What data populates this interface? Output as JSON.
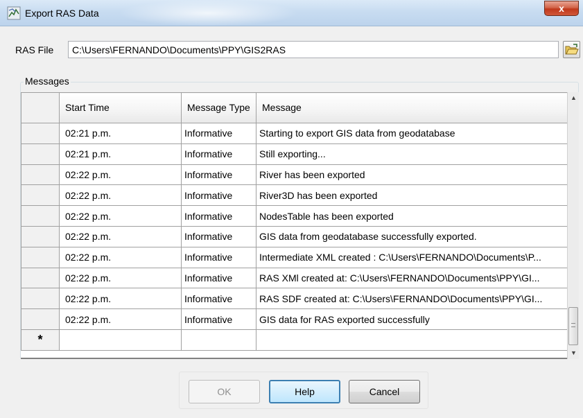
{
  "window": {
    "title": "Export RAS Data",
    "close_label": "x"
  },
  "ras_file": {
    "label": "RAS File",
    "value": "C:\\Users\\FERNANDO\\Documents\\PPY\\GIS2RAS"
  },
  "messages": {
    "group_label": "Messages",
    "columns": [
      "Start Time",
      "Message Type",
      "Message"
    ],
    "rows": [
      [
        "02:21 p.m.",
        "Informative",
        "Starting to export GIS data from geodatabase"
      ],
      [
        "02:21 p.m.",
        "Informative",
        "Still exporting..."
      ],
      [
        "02:22 p.m.",
        "Informative",
        "River has been exported"
      ],
      [
        "02:22 p.m.",
        "Informative",
        "River3D has been exported"
      ],
      [
        "02:22 p.m.",
        "Informative",
        "NodesTable has been exported"
      ],
      [
        "02:22 p.m.",
        "Informative",
        "GIS data from geodatabase successfully exported."
      ],
      [
        "02:22 p.m.",
        "Informative",
        "Intermediate XML created : C:\\Users\\FERNANDO\\Documents\\P..."
      ],
      [
        "02:22 p.m.",
        "Informative",
        "RAS XMl created at: C:\\Users\\FERNANDO\\Documents\\PPY\\GI..."
      ],
      [
        "02:22 p.m.",
        "Informative",
        "RAS SDF created at: C:\\Users\\FERNANDO\\Documents\\PPY\\GI..."
      ],
      [
        "02:22 p.m.",
        "Informative",
        "GIS data for RAS exported successfully"
      ]
    ],
    "new_row_marker": "*"
  },
  "buttons": {
    "ok": "OK",
    "help": "Help",
    "cancel": "Cancel"
  },
  "icons": {
    "app": "app-icon",
    "browse": "folder-open-icon",
    "scroll_up": "scroll-up-arrow-icon",
    "scroll_down": "scroll-down-arrow-icon"
  }
}
